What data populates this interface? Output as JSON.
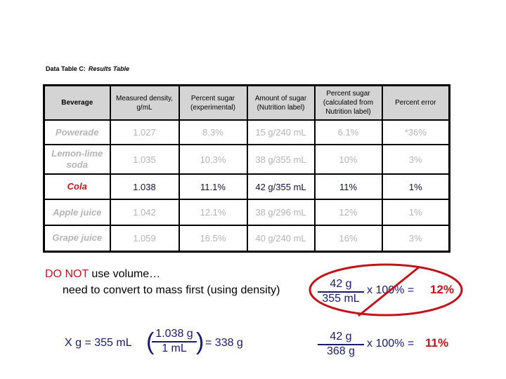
{
  "caption": {
    "label": "Data Table C:",
    "title": "Results Table"
  },
  "table": {
    "headers": [
      "Beverage",
      "Measured density, g/mL",
      "Percent sugar (experimental)",
      "Amount of sugar (Nutrition label)",
      "Percent sugar (calculated from Nutrition label)",
      "Percent error"
    ],
    "rows": [
      {
        "beverage": "Powerade",
        "density": "1.027",
        "pct_exp": "8.3%",
        "amount": "15 g/240 mL",
        "pct_label": "6.1%",
        "error": "*36%"
      },
      {
        "beverage": "Lemon-lime soda",
        "density": "1.035",
        "pct_exp": "10.3%",
        "amount": "38 g/355 mL",
        "pct_label": "10%",
        "error": "3%"
      },
      {
        "beverage": "Cola",
        "density": "1.038",
        "pct_exp": "11.1%",
        "amount": "42 g/355 mL",
        "pct_label": "11%",
        "error": "1%"
      },
      {
        "beverage": "Apple juice",
        "density": "1.042",
        "pct_exp": "12.1%",
        "amount": "38 g/296 mL",
        "pct_label": "12%",
        "error": "1%"
      },
      {
        "beverage": "Grape juice",
        "density": "1.059",
        "pct_exp": "16.5%",
        "amount": "40 g/240 mL",
        "pct_label": "16%",
        "error": "3%"
      }
    ],
    "highlighted_row": "Cola"
  },
  "notes": {
    "warning_red": "DO NOT",
    "warning_rest": " use volume…",
    "line2": "need to convert to mass first (using density)"
  },
  "wrong_calc": {
    "numerator": "42 g",
    "denominator": "355 mL",
    "times": "x 100% =",
    "result": "12%",
    "crossed_out": true
  },
  "mass_calc": {
    "lhs": "X g  = 355 mL",
    "numerator": "1.038 g",
    "denominator": "1 mL",
    "rhs": "= 338 g"
  },
  "right_calc": {
    "numerator": "42 g",
    "denominator": "368 g",
    "times": "x 100% =",
    "result": "11%"
  },
  "colors": {
    "highlight_red": "#c0141c",
    "math_navy": "#1a1a6b",
    "dim_gray": "#b4b4b4",
    "header_gray": "#d4d4d4"
  }
}
